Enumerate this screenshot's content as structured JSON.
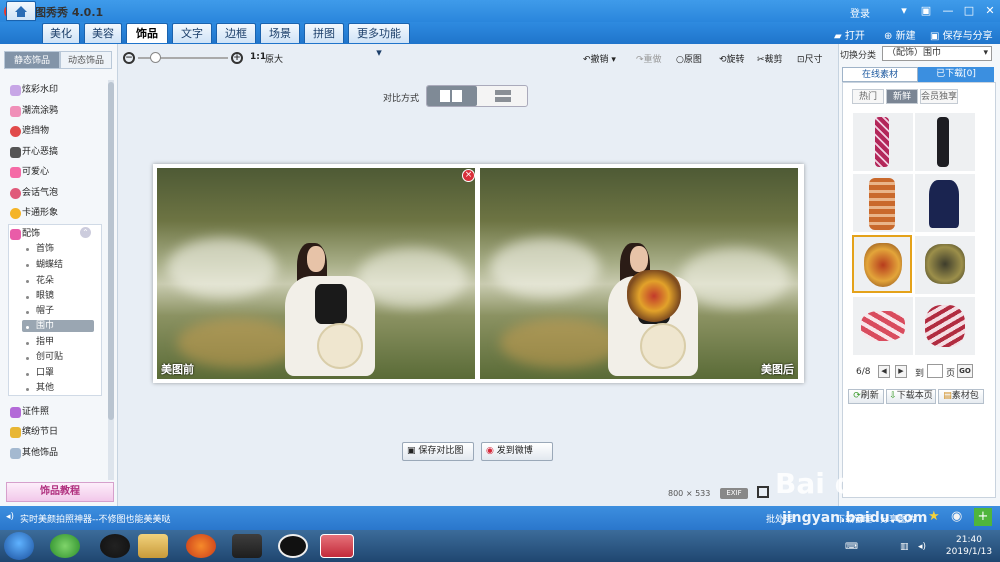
{
  "app": {
    "title": "美图秀秀 4.0.1",
    "logo_text": "秀",
    "login": "登录"
  },
  "window_controls": {
    "menu": "▾",
    "minimize": "—",
    "maximize": "□",
    "close": "✕"
  },
  "nav_tabs": [
    "美化",
    "美容",
    "饰品",
    "文字",
    "边框",
    "场景",
    "拼图",
    "更多功能 ▾"
  ],
  "top_tools": {
    "open": "打开",
    "new": "新建",
    "save_share": "保存与分享"
  },
  "left_panel": {
    "tabs": [
      "静态饰品",
      "动态饰品"
    ],
    "categories_top": [
      "炫彩水印",
      "潮流涂鸦",
      "遮挡物",
      "开心恶搞",
      "可爱心",
      "会话气泡",
      "卡通形象"
    ],
    "expanded_category": "配饰",
    "subcategories": [
      "首饰",
      "蝴蝶结",
      "花朵",
      "眼镜",
      "帽子",
      "围巾",
      "指甲",
      "创可贴",
      "口罩",
      "其他"
    ],
    "selected_subcategory": "围巾",
    "categories_bottom": [
      "证件照",
      "缤纷节日",
      "其他饰品"
    ],
    "tutorial": "饰品教程"
  },
  "toolbar": {
    "ratio": "1:1",
    "original_size": "原大",
    "undo": "撤销",
    "redo": "重做",
    "original": "原图",
    "rotate": "旋转",
    "crop": "裁剪",
    "resize": "尺寸"
  },
  "compare": {
    "label": "对比方式",
    "mode_selected": "side-by-side"
  },
  "photos": {
    "before": "美图前",
    "after": "美图后"
  },
  "buttons": {
    "save_compare": "保存对比图",
    "post_weibo": "发到微博"
  },
  "image_info": {
    "width": "800",
    "x": "×",
    "height": "533",
    "exif": "EXIF"
  },
  "right_panel": {
    "switch_label": "切换分类",
    "category": "（配饰）围巾",
    "tabs": [
      "在线素材",
      "已下载[0]"
    ],
    "filters": [
      "热门",
      "新鲜",
      "会员独享"
    ],
    "active_filter": "新鲜",
    "pager": {
      "current": "6/8",
      "to": "到",
      "page": "页",
      "go": "GO"
    },
    "actions": [
      "刷新",
      "下载本页",
      "素材包"
    ]
  },
  "status": {
    "message": "实时美颜拍照神器--不修图也能美美哒",
    "batch": "批处理",
    "download_mgr": "下载管理",
    "share": "分享图片"
  },
  "taskbar": {
    "time": "21:40",
    "date": "2019/1/13"
  },
  "watermark": {
    "main": "Bai du 经验",
    "url": "jingyan.baidu.com"
  }
}
